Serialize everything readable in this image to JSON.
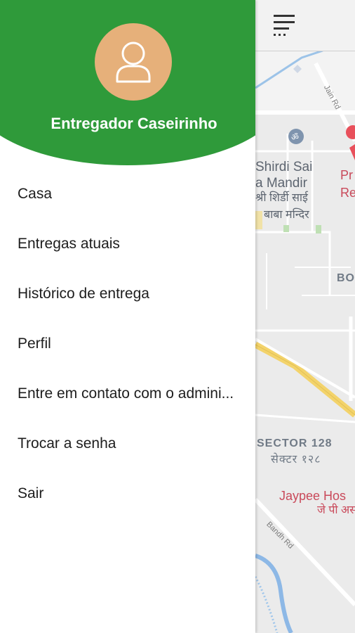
{
  "drawer": {
    "user_name": "Entregador Caseirinho",
    "avatar_icon": "user-icon",
    "header_color": "#2f9a3a",
    "avatar_color": "#e6b07a",
    "items": [
      {
        "label": "Casa"
      },
      {
        "label": "Entregas atuais"
      },
      {
        "label": "Histórico de entrega"
      },
      {
        "label": "Perfil"
      },
      {
        "label": "Entre em contato com o admini..."
      },
      {
        "label": "Trocar a senha"
      },
      {
        "label": "Sair"
      }
    ]
  },
  "appbar": {
    "menu_icon": "menu-icon"
  },
  "map": {
    "labels": {
      "temple_line1": "Shirdi Sai",
      "temple_line2": "a Mandir",
      "temple_hindi1": "श्री शिर्डी साई",
      "temple_hindi2": "बाबा मन्दिर",
      "poi_red1": "Pr",
      "poi_red2": "Re",
      "bo": "BO",
      "sector": "SECTOR 128",
      "sector_hindi": "सेक्टर १२८",
      "hospital": "Jaypee Hos",
      "hospital_hindi": "जे पी अस",
      "road_jain": "Jain Rd",
      "road_bandh": "Bandh Rd"
    }
  }
}
